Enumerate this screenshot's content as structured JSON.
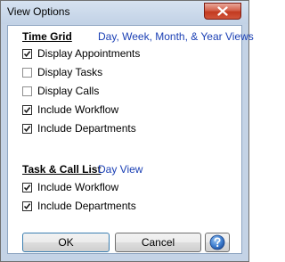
{
  "window": {
    "title": "View Options"
  },
  "time_grid": {
    "title": "Time Grid",
    "link": "Day, Week, Month, & Year Views",
    "options": [
      {
        "label": "Display Appointments",
        "checked": true
      },
      {
        "label": "Display Tasks",
        "checked": false
      },
      {
        "label": "Display Calls",
        "checked": false
      },
      {
        "label": "Include Workflow",
        "checked": true
      },
      {
        "label": "Include Departments",
        "checked": true
      }
    ]
  },
  "task_call_list": {
    "title": "Task & Call List",
    "link": "Day View",
    "options": [
      {
        "label": "Include Workflow",
        "checked": true
      },
      {
        "label": "Include Departments",
        "checked": true
      }
    ]
  },
  "buttons": {
    "ok": "OK",
    "cancel": "Cancel",
    "help_icon": "help-icon"
  },
  "colors": {
    "link": "#1a3fb4",
    "frame": "#c4d3e6",
    "close": "#c23a20"
  }
}
